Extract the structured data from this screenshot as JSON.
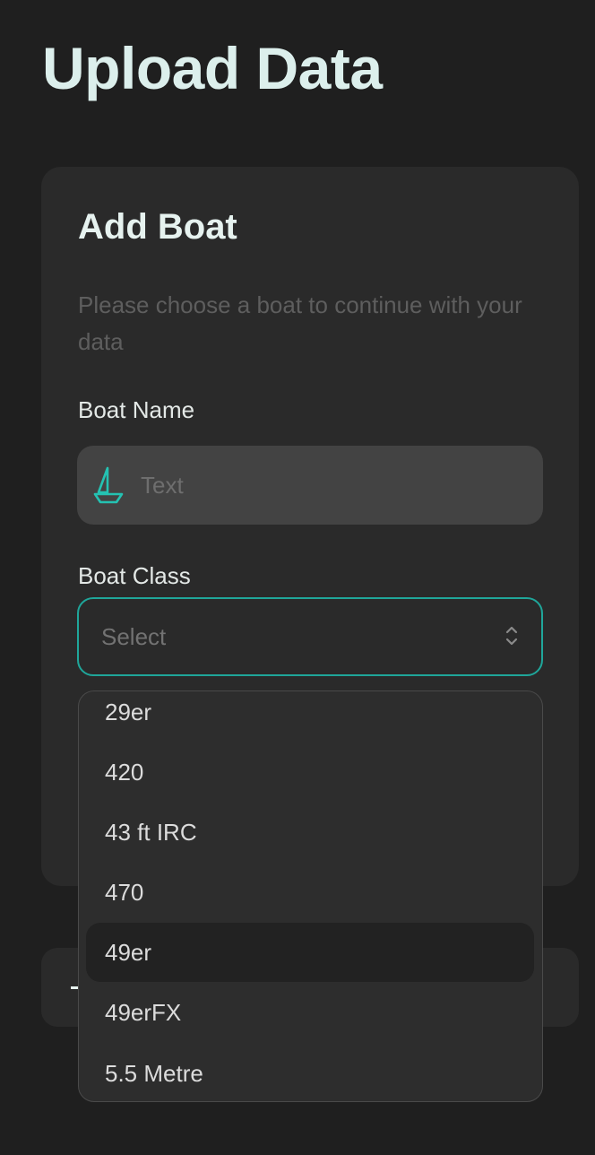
{
  "page": {
    "title": "Upload Data"
  },
  "card": {
    "title": "Add Boat",
    "description": "Please choose a boat to continue with your data",
    "boat_name": {
      "label": "Boat Name",
      "placeholder": "Text",
      "icon": "sailboat-icon"
    },
    "boat_class": {
      "label": "Boat Class",
      "selected": "Select",
      "icon": "chevron-up-down-icon"
    }
  },
  "dropdown": {
    "options": [
      "29er",
      "420",
      "43 ft IRC",
      "470",
      "49er",
      "49erFX",
      "5.5 Metre"
    ],
    "highlighted": "49er"
  },
  "colors": {
    "background": "#1f1f1f",
    "card": "#2a2a2a",
    "accent": "#1fa69a",
    "title": "#dcefec"
  }
}
